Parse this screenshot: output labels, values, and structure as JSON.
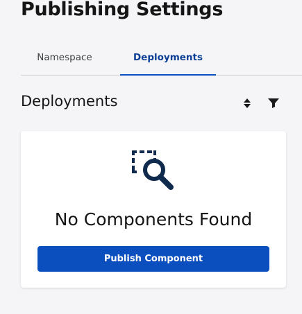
{
  "page": {
    "title": "Publishing Settings"
  },
  "tabs": [
    {
      "label": "Namespace",
      "active": false
    },
    {
      "label": "Deployments",
      "active": true
    }
  ],
  "section": {
    "title": "Deployments",
    "sort_icon": "sort-icon",
    "filter_icon": "filter-icon"
  },
  "empty_state": {
    "icon": "search-icon",
    "title": "No Components Found",
    "button_label": "Publish Component"
  },
  "colors": {
    "accent": "#0b4fbf",
    "active_tab_text": "#0b3f96",
    "icon": "#0f2a4d"
  }
}
